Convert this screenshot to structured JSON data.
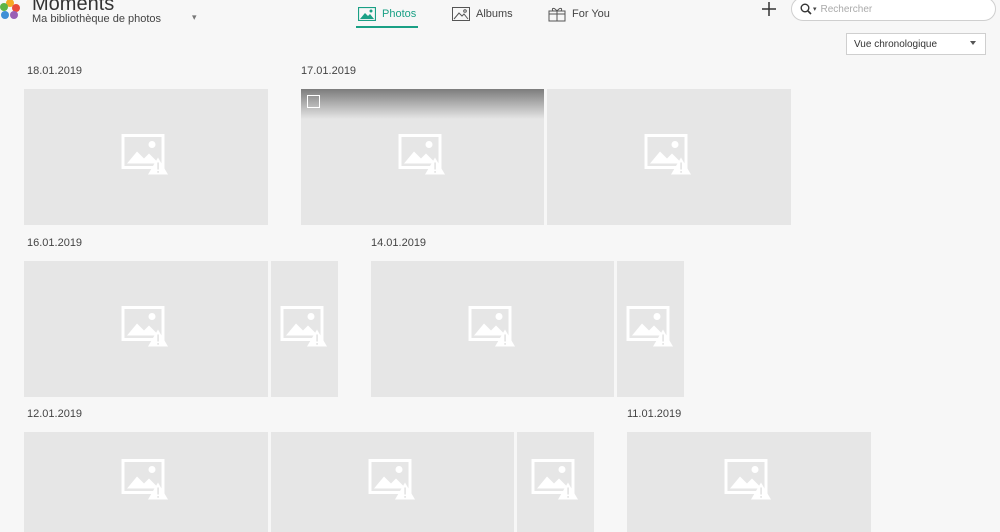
{
  "header": {
    "app_title": "Moments",
    "library_label": "Ma bibliothèque de photos",
    "library_dropdown_icon": "chevron-down-icon",
    "logo_colors": [
      "#f7a823",
      "#e94b3c",
      "#5fb446",
      "#3f8fd6",
      "#9a5fb5"
    ]
  },
  "tabs": [
    {
      "label": "Photos",
      "icon": "photo-icon",
      "active": true
    },
    {
      "label": "Albums",
      "icon": "album-icon",
      "active": false
    },
    {
      "label": "For You",
      "icon": "gift-icon",
      "active": false
    }
  ],
  "search": {
    "placeholder": "Rechercher",
    "icon": "search-icon"
  },
  "add_button_icon": "plus-icon",
  "view_select": {
    "selected": "Vue chronologique"
  },
  "accent_color": "#1aa085",
  "groups": [
    {
      "date": "18.01.2019",
      "photo_count": 1
    },
    {
      "date": "17.01.2019",
      "photo_count": 2
    },
    {
      "date": "16.01.2019",
      "photo_count": 2
    },
    {
      "date": "14.01.2019",
      "photo_count": 2
    },
    {
      "date": "12.01.2019",
      "photo_count": 3
    },
    {
      "date": "11.01.2019",
      "photo_count": 1
    }
  ],
  "placeholder_icon": "broken-image-warning-icon"
}
